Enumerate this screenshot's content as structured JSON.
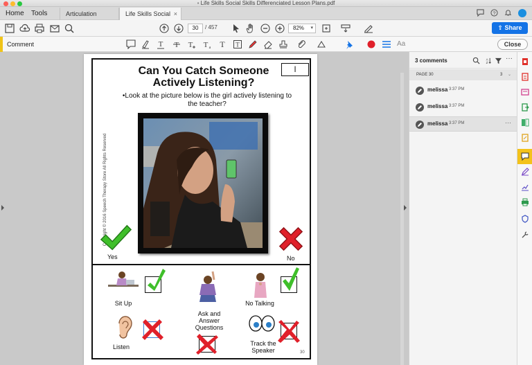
{
  "window": {
    "title": "Life Skills Social Skills Differenciated Lesson Plans.pdf"
  },
  "nav": {
    "home": "Home",
    "tools": "Tools"
  },
  "tabs": [
    {
      "label": "Articulation Readi..."
    },
    {
      "label": "Life Skills Social S...",
      "close": "×"
    }
  ],
  "toolbar": {
    "page_current": "30",
    "page_total": "/ 457",
    "zoom": "82%",
    "share_label": "Share"
  },
  "comment_toolbar": {
    "label": "Comment",
    "aa": "Aa",
    "close_label": "Close"
  },
  "document": {
    "title": "Can You Catch Someone Actively Listening?",
    "page_box": "I",
    "question": "•Look at the picture below is the girl actively listening to the teacher?",
    "copyright": "Copyright © 2016 Speech Therapy Store All Rights Reserved",
    "yes": "Yes",
    "no": "No",
    "skills": [
      "Sit Up",
      "Ask and Answer Questions",
      "No Talking",
      "Listen",
      "Track the Speaker"
    ],
    "page_number": "30"
  },
  "comments_panel": {
    "count_label": "3 comments",
    "page_label": "PAGE 30",
    "page_count": "3",
    "comments": [
      {
        "author": "melissa",
        "time": "3:37 PM"
      },
      {
        "author": "melissa",
        "time": "3:37 PM"
      },
      {
        "author": "melissa",
        "time": "3:37 PM",
        "more": "···"
      }
    ]
  },
  "colors": {
    "accent": "#1473e6",
    "comment_accent": "#f0c419",
    "check": "#3fbf2a",
    "cross": "#e0202a"
  }
}
